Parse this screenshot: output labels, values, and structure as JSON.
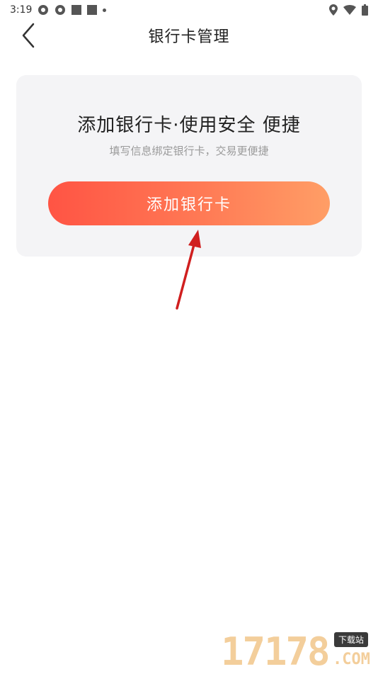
{
  "status_bar": {
    "time": "3:19"
  },
  "header": {
    "title": "银行卡管理",
    "back_icon": "chevron-left-icon"
  },
  "card": {
    "title": "添加银行卡·使用安全 便捷",
    "subtitle": "填写信息绑定银行卡，交易更便捷",
    "button_label": "添加银行卡"
  },
  "watermark": {
    "number": "17178",
    "badge": "下载站",
    "suffix": ".COM"
  },
  "colors": {
    "button_gradient_start": "#ff5444",
    "button_gradient_end": "#ff9e66",
    "card_background": "#f4f4f6",
    "annotation_arrow": "#d01f1f"
  }
}
